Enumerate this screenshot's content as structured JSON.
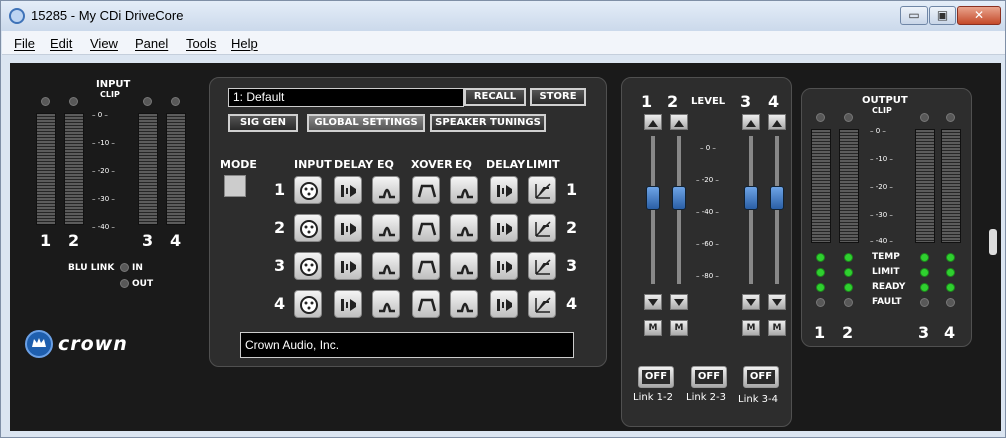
{
  "window": {
    "title": "15285 - My CDi DriveCore",
    "min": "▭",
    "max": "▣",
    "close": "✕"
  },
  "menu": [
    "File",
    "Edit",
    "View",
    "Panel",
    "Tools",
    "Help"
  ],
  "input": {
    "title": "INPUT",
    "clip": "CLIP",
    "ticks": [
      "0",
      "-10",
      "-20",
      "-30",
      "-40"
    ],
    "channels": [
      "1",
      "2",
      "3",
      "4"
    ],
    "blu_link": "BLU LINK",
    "in": "IN",
    "out": "OUT"
  },
  "brand": "crown",
  "center": {
    "preset": "1: Default",
    "recall": "RECALL",
    "store": "STORE",
    "sig_gen": "SIG GEN",
    "global": "GLOBAL SETTINGS",
    "speaker": "SPEAKER TUNINGS",
    "mode": "MODE",
    "headers": [
      "INPUT",
      "DELAY",
      "EQ",
      "XOVER",
      "EQ",
      "DELAY",
      "LIMIT"
    ],
    "rows": [
      "1",
      "2",
      "3",
      "4"
    ],
    "status": "Crown Audio, Inc."
  },
  "level": {
    "label": "LEVEL",
    "channels": [
      "1",
      "2",
      "3",
      "4"
    ],
    "ticks": [
      "0",
      "-20",
      "-40",
      "-60",
      "-80"
    ],
    "mute": "M",
    "links": [
      {
        "state": "OFF",
        "label": "Link 1-2"
      },
      {
        "state": "OFF",
        "label": "Link 2-3"
      },
      {
        "state": "OFF",
        "label": "Link 3-4"
      }
    ]
  },
  "output": {
    "title": "OUTPUT",
    "clip": "CLIP",
    "ticks": [
      "0",
      "-10",
      "-20",
      "-30",
      "-40"
    ],
    "status": [
      "TEMP",
      "LIMIT",
      "READY",
      "FAULT"
    ],
    "channels": [
      "1",
      "2",
      "3",
      "4"
    ]
  }
}
